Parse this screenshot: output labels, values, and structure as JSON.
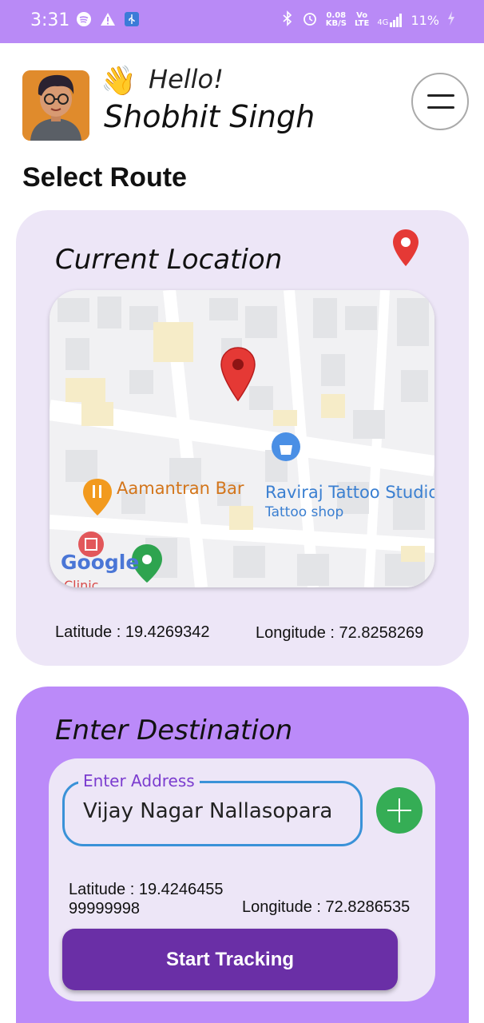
{
  "status_bar": {
    "time": "3:31",
    "network_speed_value": "0.08",
    "network_speed_unit": "KB/S",
    "volte_top": "Vo",
    "volte_bottom": "LTE",
    "signal_label": "4G",
    "battery": "11%",
    "icons": [
      "spotify-icon",
      "warning-icon",
      "usb-icon",
      "bluetooth-icon",
      "alarm-icon",
      "signal-icon",
      "charging-icon"
    ]
  },
  "header": {
    "greeting_emoji": "👋",
    "greeting": "Hello!",
    "user_name": "Shobhit Singh"
  },
  "page": {
    "section_title": "Select Route"
  },
  "current_location": {
    "heading": "Current Location",
    "latitude_label": "Latitude : 19.4269342",
    "longitude_label": "Longitude : 72.8258269",
    "map": {
      "places": [
        {
          "name": "Aamantran Bar",
          "type": "restaurant"
        },
        {
          "name": "Raviraj Tattoo Studio",
          "subtitle": "Tattoo shop",
          "type": "shop"
        },
        {
          "name": "Clinic",
          "type": "medical"
        }
      ],
      "provider_logo": "Google"
    }
  },
  "destination": {
    "heading": "Enter Destination",
    "address_label": "Enter Address",
    "address_value": "Vijay Nagar Nallasopara",
    "latitude_line1": "Latitude : 19.4246455",
    "latitude_line2": "99999998",
    "longitude_label": "Longitude : 72.8286535",
    "start_button": "Start Tracking"
  },
  "colors": {
    "status_bar": "#b98af6",
    "current_card": "#ede6f7",
    "destination_card": "#bb8af9",
    "start_button": "#6a2fa6",
    "add_button": "#35ad55",
    "field_border": "#3a92d8",
    "pin_red": "#e53935"
  }
}
